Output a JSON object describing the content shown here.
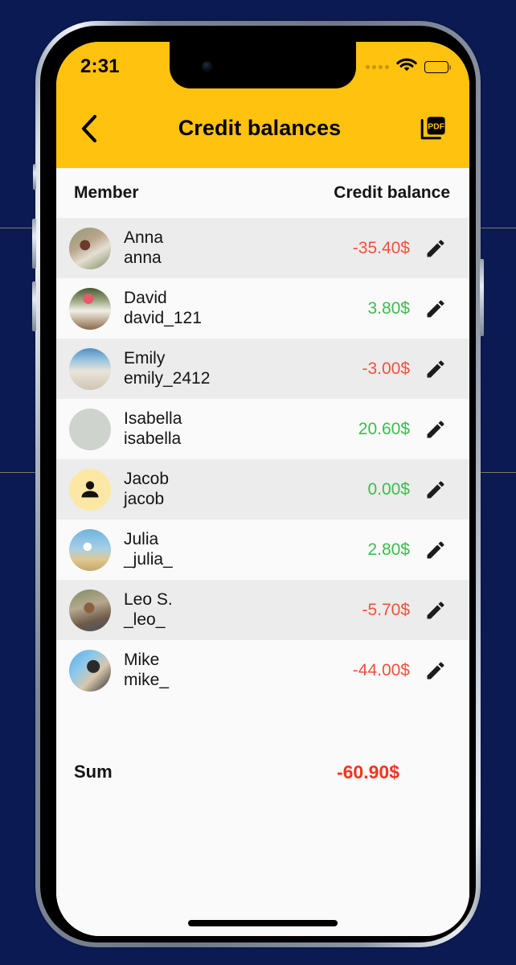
{
  "theme": {
    "brand_yellow": "#ffc20e",
    "backdrop": "#0b1a52",
    "negative_color": "#f4503c",
    "positive_color": "#3cbd4c",
    "sum_color": "#f4341e",
    "row_odd": "#ececec",
    "row_even": "#fafafa"
  },
  "status_bar": {
    "time": "2:31",
    "signal_icon": "cellular-dots-icon",
    "wifi_icon": "wifi-icon",
    "battery_icon": "battery-full-icon"
  },
  "appbar": {
    "back_icon": "chevron-left-icon",
    "title": "Credit balances",
    "export_icon": "pdf-export-icon",
    "export_label": "PDF"
  },
  "table": {
    "headers": {
      "member": "Member",
      "balance": "Credit balance"
    },
    "rows": [
      {
        "name": "Anna",
        "handle": "anna",
        "amount": "-35.40$",
        "sign": "neg",
        "avatar": "photo",
        "avatar_class": "ph-anna"
      },
      {
        "name": "David",
        "handle": "david_121",
        "amount": "3.80$",
        "sign": "pos",
        "avatar": "photo",
        "avatar_class": "ph-david"
      },
      {
        "name": "Emily",
        "handle": "emily_2412",
        "amount": "-3.00$",
        "sign": "neg",
        "avatar": "photo",
        "avatar_class": "ph-emily"
      },
      {
        "name": "Isabella",
        "handle": "isabella",
        "amount": "20.60$",
        "sign": "pos",
        "avatar": "photo",
        "avatar_class": "ph-isabella"
      },
      {
        "name": "Jacob",
        "handle": "jacob",
        "amount": "0.00$",
        "sign": "pos",
        "avatar": "placeholder",
        "avatar_class": ""
      },
      {
        "name": "Julia",
        "handle": "_julia_",
        "amount": "2.80$",
        "sign": "pos",
        "avatar": "photo",
        "avatar_class": "ph-julia"
      },
      {
        "name": "Leo S.",
        "handle": "_leo_",
        "amount": "-5.70$",
        "sign": "neg",
        "avatar": "photo",
        "avatar_class": "ph-leo"
      },
      {
        "name": "Mike",
        "handle": "mike_",
        "amount": "-44.00$",
        "sign": "neg",
        "avatar": "photo",
        "avatar_class": "ph-mike"
      }
    ],
    "edit_icon": "pencil-icon"
  },
  "summary": {
    "label": "Sum",
    "value": "-60.90$"
  },
  "home_indicator": "home-indicator"
}
